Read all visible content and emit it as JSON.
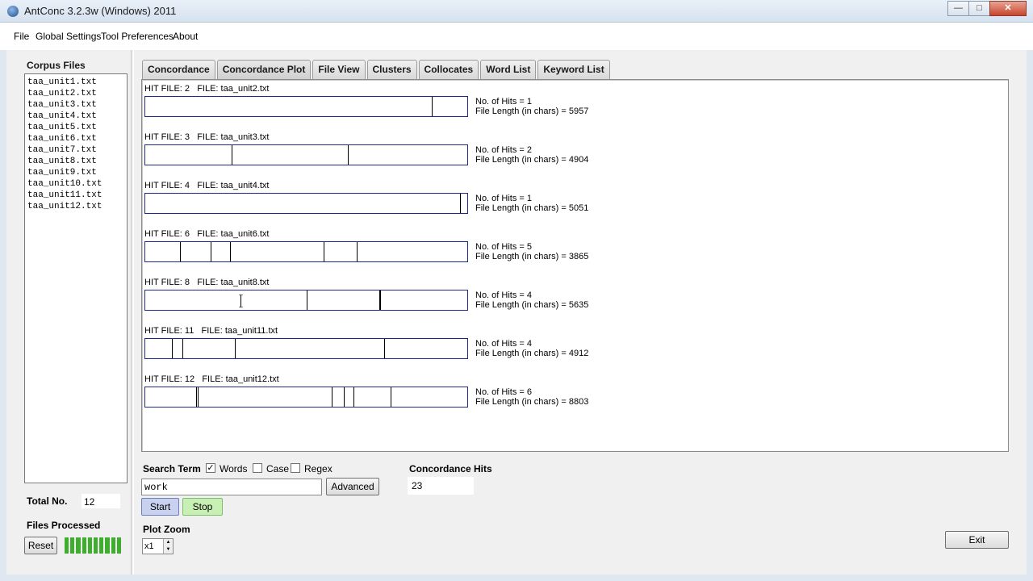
{
  "window": {
    "title": "AntConc 3.2.3w (Windows) 2011",
    "minimize": "—",
    "maximize": "□",
    "close": "✕"
  },
  "menu": [
    "File",
    "Global Settings",
    "Tool Preferences",
    "About"
  ],
  "sidebar": {
    "corpus_title": "Corpus Files",
    "files": [
      "taa_unit1.txt",
      "taa_unit2.txt",
      "taa_unit3.txt",
      "taa_unit4.txt",
      "taa_unit5.txt",
      "taa_unit6.txt",
      "taa_unit7.txt",
      "taa_unit8.txt",
      "taa_unit9.txt",
      "taa_unit10.txt",
      "taa_unit11.txt",
      "taa_unit12.txt"
    ],
    "total_label": "Total No.",
    "total_value": "12",
    "files_processed_label": "Files Processed",
    "reset_label": "Reset",
    "progress_fraction": 1.0
  },
  "tabs": [
    {
      "label": "Concordance",
      "active": false
    },
    {
      "label": "Concordance Plot",
      "active": true
    },
    {
      "label": "File View",
      "active": false
    },
    {
      "label": "Clusters",
      "active": false
    },
    {
      "label": "Collocates",
      "active": false
    },
    {
      "label": "Word List",
      "active": false
    },
    {
      "label": "Keyword List",
      "active": false
    }
  ],
  "plot": {
    "hits": [
      {
        "label": "HIT FILE: 2   FILE: taa_unit2.txt",
        "hits_text": "No. of Hits = 1",
        "length_text": "File Length (in chars) = 5957",
        "marks": [
          0.89
        ]
      },
      {
        "label": "HIT FILE: 3   FILE: taa_unit3.txt",
        "hits_text": "No. of Hits = 2",
        "length_text": "File Length (in chars) = 4904",
        "marks": [
          0.267,
          0.628
        ]
      },
      {
        "label": "HIT FILE: 4   FILE: taa_unit4.txt",
        "hits_text": "No. of Hits = 1",
        "length_text": "File Length (in chars) = 5051",
        "marks": [
          0.978
        ]
      },
      {
        "label": "HIT FILE: 6   FILE: taa_unit6.txt",
        "hits_text": "No. of Hits = 5",
        "length_text": "File Length (in chars) = 3865",
        "marks": [
          0.107,
          0.204,
          0.262,
          0.554,
          0.656
        ]
      },
      {
        "label": "HIT FILE: 8   FILE: taa_unit8.txt",
        "hits_text": "No. of Hits = 4",
        "length_text": "File Length (in chars) = 5635",
        "marks": [
          0.501,
          0.726,
          0.728,
          0.729
        ]
      },
      {
        "label": "HIT FILE: 11   FILE: taa_unit11.txt",
        "hits_text": "No. of Hits = 4",
        "length_text": "File Length (in chars) = 4912",
        "marks": [
          0.082,
          0.115,
          0.277,
          0.743
        ]
      },
      {
        "label": "HIT FILE: 12   FILE: taa_unit12.txt",
        "hits_text": "No. of Hits = 6",
        "length_text": "File Length (in chars) = 8803",
        "marks": [
          0.157,
          0.162,
          0.578,
          0.616,
          0.646,
          0.761
        ]
      }
    ]
  },
  "search": {
    "label": "Search Term",
    "words_label": "Words",
    "words_checked": true,
    "case_label": "Case",
    "case_checked": false,
    "regex_label": "Regex",
    "regex_checked": false,
    "term": "work",
    "advanced_label": "Advanced",
    "start_label": "Start",
    "stop_label": "Stop"
  },
  "concordance_hits": {
    "label": "Concordance Hits",
    "value": "23"
  },
  "zoom": {
    "label": "Plot Zoom",
    "value": "x1"
  },
  "exit_label": "Exit",
  "colors": {
    "progress": "#3fae2e",
    "plot_border": "#1b2a8a",
    "start_bg": "#c8d2f0",
    "stop_bg": "#c8f0b4"
  }
}
